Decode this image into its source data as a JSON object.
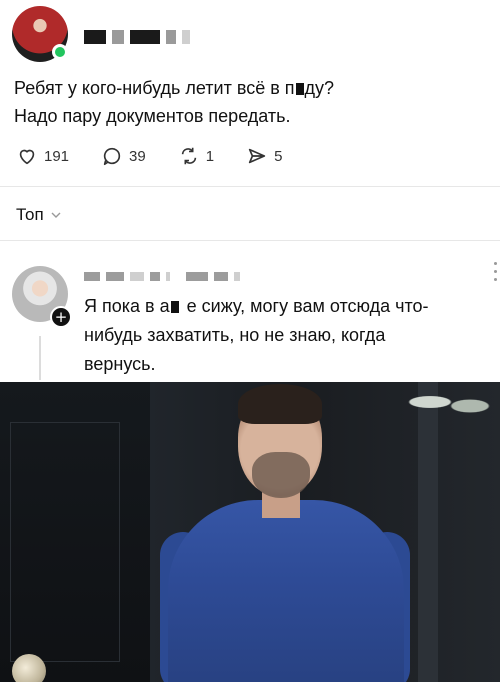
{
  "post": {
    "author_redacted": true,
    "text_line1": "Ребят у кого-нибудь летит всё в п",
    "text_line1_after": "ду?",
    "text_line2": "Надо пару документов передать."
  },
  "actions": {
    "likes": "191",
    "comments": "39",
    "reposts": "1",
    "shares": "5"
  },
  "sort": {
    "label": "Топ"
  },
  "comment": {
    "author_redacted": true,
    "line1_a": "Я пока в а",
    "line1_b": "е сижу, могу вам отсюда что-",
    "line2": "нибудь захватить, но не знаю, когда",
    "line3": "вернусь."
  },
  "icons": {
    "like": "heart-icon",
    "comment": "speech-bubble-icon",
    "repost": "repost-arrows-icon",
    "share": "send-icon",
    "sort": "chevron-down-icon",
    "more": "more-dots-icon",
    "plus": "plus-icon"
  },
  "colors": {
    "online": "#22c55e",
    "text": "#111111",
    "muted": "#333333",
    "divider": "#e7e7e7"
  }
}
